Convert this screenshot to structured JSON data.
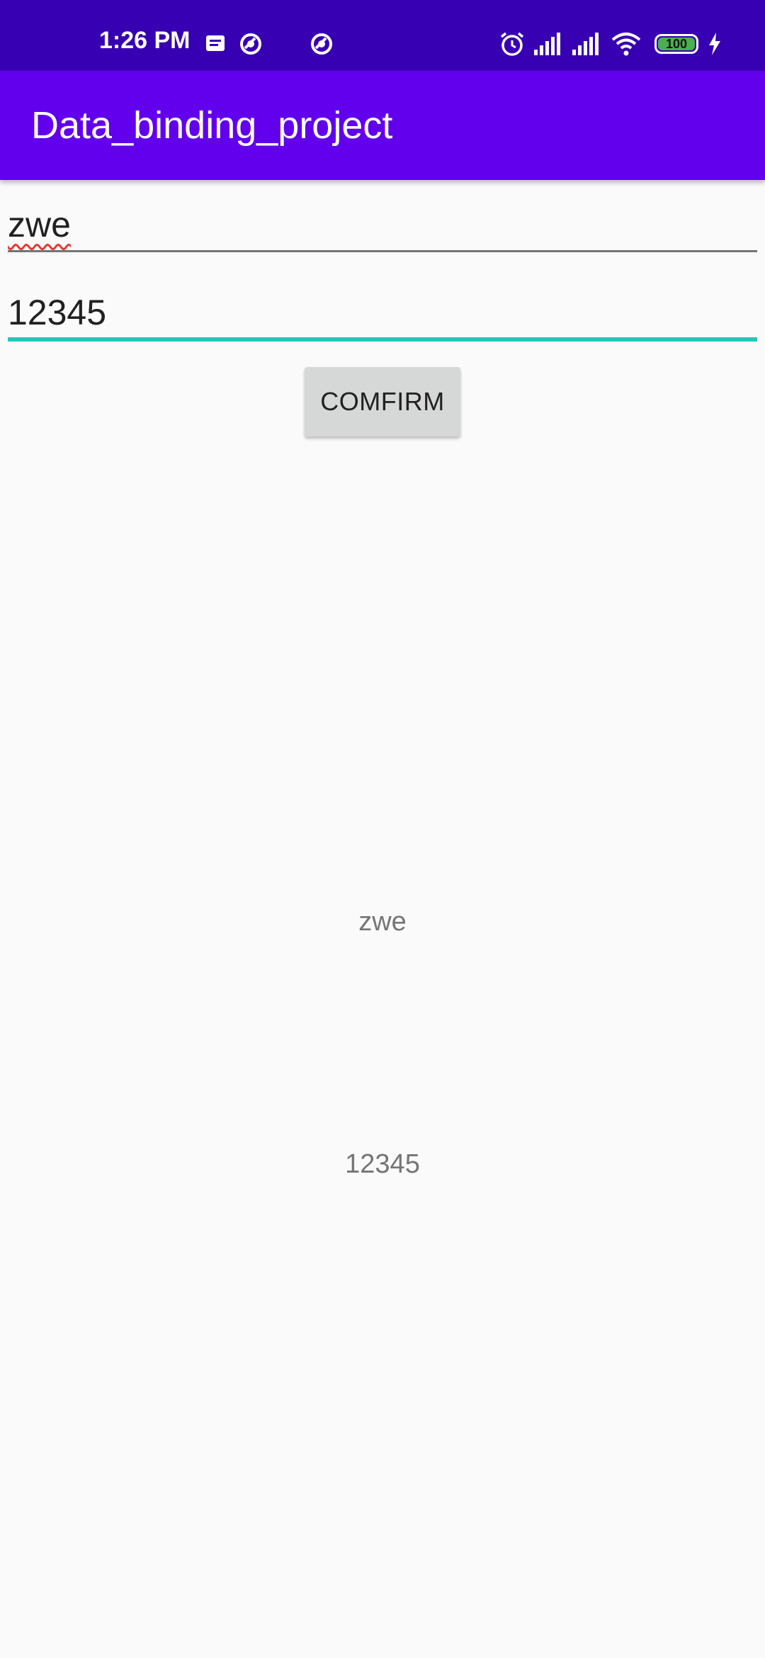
{
  "status_bar": {
    "time": "1:26 PM",
    "battery_level": "100",
    "icons": [
      "notification-icon",
      "sync-icon",
      "sync-icon",
      "alarm-icon",
      "signal-icon",
      "signal-icon",
      "wifi-icon",
      "battery-icon",
      "charging-icon"
    ],
    "background": "#3700b3"
  },
  "app_bar": {
    "title": "Data_binding_project",
    "background": "#6200ee"
  },
  "form": {
    "name_value": "zwe",
    "number_value": "12345",
    "confirm_label": "COMFIRM",
    "accent": "#26c6b8"
  },
  "output": {
    "name_text": "zwe",
    "number_text": "12345"
  }
}
